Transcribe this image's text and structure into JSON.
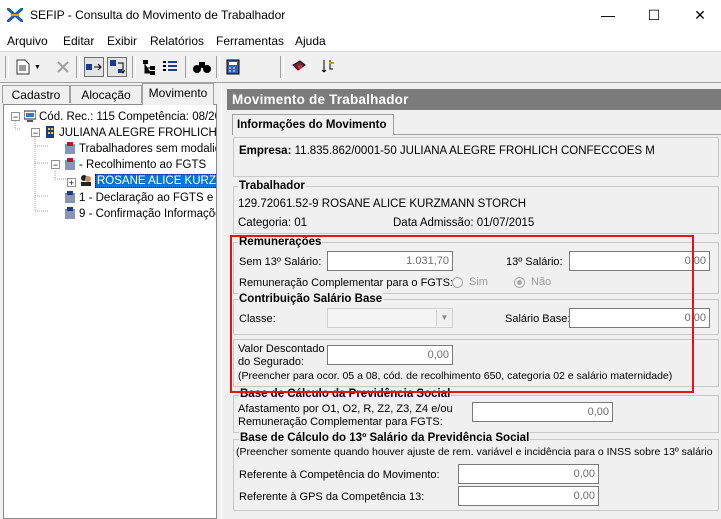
{
  "window": {
    "title": "SEFIP - Consulta do Movimento de Trabalhador",
    "minimize": "—",
    "maximize": "☐",
    "close": "✕"
  },
  "menu": [
    "Arquivo",
    "Editar",
    "Exibir",
    "Relatórios",
    "Ferramentas",
    "Ajuda"
  ],
  "toolbar_icons": [
    "new-doc-icon",
    "delete-icon",
    "move-right-icon",
    "move-down-icon",
    "tree-icon",
    "list-icon",
    "binoculars-icon",
    "calculator-icon",
    "book-icon",
    "import-icon"
  ],
  "left_tabs": [
    "Cadastro",
    "Alocação",
    "Movimento"
  ],
  "tree": {
    "root": "Cód. Rec.: 115 Competência: 08/20",
    "company": "JULIANA ALEGRE FROHLICH",
    "workers_without": "Trabalhadores sem modalid",
    "recolhimento": "- Recolhimento ao FGTS",
    "selected_worker": "ROSANE ALICE KURZ",
    "declaracao": "1 - Declaração ao FGTS e .",
    "confirmacao": "9 - Confirmação Informaçõe"
  },
  "panel": {
    "header": "Movimento de Trabalhador",
    "tab": "Informações do Movimento",
    "empresa_label": "Empresa:",
    "empresa_value": "11.835.862/0001-50  JULIANA ALEGRE FROHLICH CONFECCOES M",
    "trabalhador_title": "Trabalhador",
    "trabalhador_value": "129.72061.52-9 ROSANE ALICE KURZMANN STORCH",
    "categoria": "Categoria: 01",
    "admissao": "Data Admissão: 01/07/2015",
    "remuneracoes_title": "Remunerações",
    "sem13_label": "Sem 13º Salário:",
    "sem13_value": "1.031,70",
    "sal13_label": "13º Salário:",
    "sal13_value": "0,00",
    "rem_compl_label": "Remuneração Complementar para o FGTS:",
    "sim": "Sim",
    "nao": "Não",
    "contrib_title": "Contribuição Salário Base",
    "classe_label": "Classe:",
    "classe_value": "",
    "salario_base_label": "Salário Base:",
    "salario_base_value": "0,00",
    "valor_desc_label_1": "Valor Descontado",
    "valor_desc_label_2": "do Segurado:",
    "valor_desc_value": "0,00",
    "valor_desc_note": "(Preencher para ocor. 05 a 08, cód. de recolhimento 650, categoria 02 e salário maternidade)",
    "base_prev_title": "Base de Cálculo da Previdência Social",
    "afast_label_1": "Afastamento por O1, O2, R, Z2, Z3, Z4 e/ou",
    "afast_label_2": "Remuneração Complementar para FGTS:",
    "afast_value": "0,00",
    "base13_title": "Base de Cálculo do 13º Salário da Previdência Social",
    "base13_note": "(Preencher somente quando houver ajuste de rem. variável e incidência para o INSS sobre 13º salário",
    "ref_comp_label": "Referente à Competência do Movimento:",
    "ref_comp_value": "0,00",
    "ref_gps_label": "Referente à GPS da Competência 13:",
    "ref_gps_value": "0,00"
  }
}
